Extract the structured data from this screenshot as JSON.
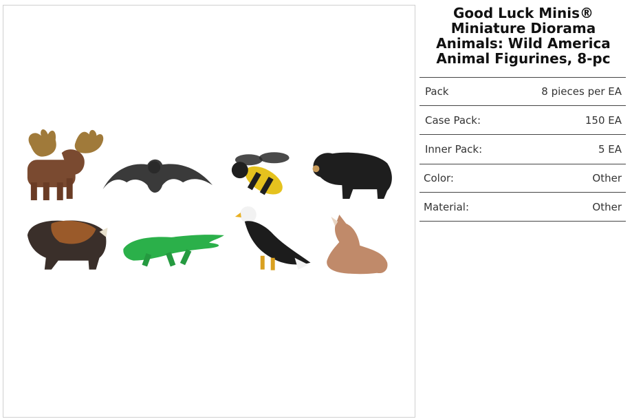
{
  "product": {
    "title": "Good Luck Minis® Miniature Diorama Animals: Wild America Animal Figurines, 8-pc"
  },
  "specs": [
    {
      "label": "Pack",
      "value": "8 pieces per EA"
    },
    {
      "label": "Case Pack:",
      "value": "150 EA"
    },
    {
      "label": "Inner Pack:",
      "value": "5 EA"
    },
    {
      "label": "Color:",
      "value": "Other"
    },
    {
      "label": "Material:",
      "value": "Other"
    }
  ],
  "figurines": [
    "moose-icon",
    "bat-icon",
    "bee-icon",
    "black-bear-icon",
    "bison-icon",
    "alligator-icon",
    "bald-eagle-icon",
    "wolf-pup-icon"
  ]
}
